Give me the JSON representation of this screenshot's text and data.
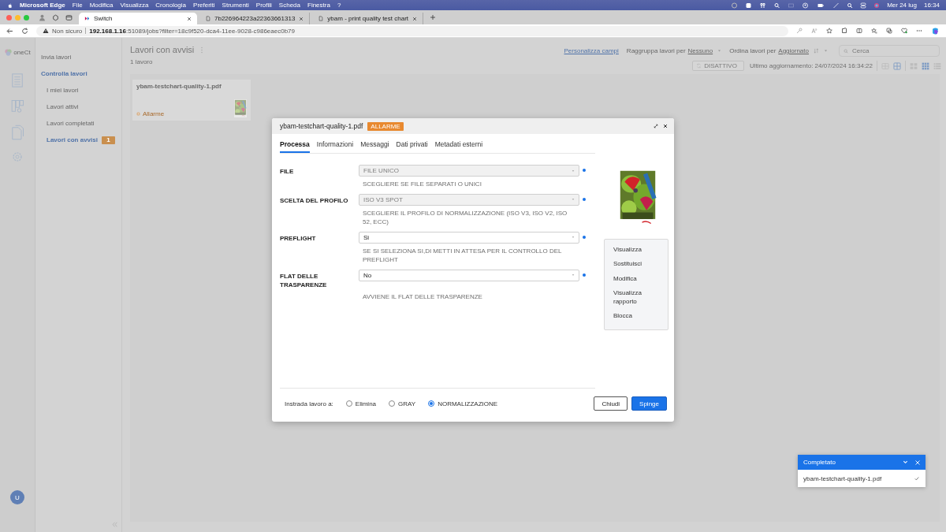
{
  "menubar": {
    "app": "Microsoft Edge",
    "menus": [
      "File",
      "Modifica",
      "Visualizza",
      "Cronologia",
      "Preferiti",
      "Strumenti",
      "Profili",
      "Scheda",
      "Finestra",
      "?"
    ],
    "date": "Mer 24 lug",
    "time": "16:34"
  },
  "browser": {
    "tabs": [
      {
        "title": "Switch",
        "selected": true
      },
      {
        "title": "7b226964223a22363661313",
        "selected": false
      },
      {
        "title": "ybam - print quality test chart",
        "selected": false
      }
    ],
    "security": "Non sicuro",
    "host": "192.168.1.16",
    "path": ":51089/jobs?filter=18c9f520-dca4-11ee-9028-c986eaec0b79"
  },
  "sidebar": {
    "logo": "oneCt",
    "avatar": "U"
  },
  "nav": {
    "items": [
      {
        "label": "Invia lavori",
        "kind": "link"
      },
      {
        "label": "Controlla lavori",
        "kind": "section",
        "children": [
          {
            "label": "I miei lavori",
            "selected": false
          },
          {
            "label": "Lavori attivi",
            "selected": false
          },
          {
            "label": "Lavori completati",
            "selected": false
          },
          {
            "label": "Lavori con avvisi",
            "selected": true,
            "badge": "1"
          }
        ]
      }
    ]
  },
  "main": {
    "title": "Lavori con avvisi",
    "count": "1 lavoro",
    "customize": "Personalizza campi",
    "group_label": "Raggruppa lavori per",
    "group_value": "Nessuno",
    "sort_label": "Ordina lavori per",
    "sort_value": "Aggiornato",
    "search": {
      "placeholder": "Cerca"
    },
    "refresh": "DISATTIVO",
    "last_update": "Ultimo aggiornamento: 24/07/2024 16:34:22",
    "layout_views": [
      {
        "selected": false
      },
      {
        "selected": true
      }
    ],
    "density_views": [
      {
        "selected": false
      },
      {
        "selected": true
      },
      {
        "selected": false
      }
    ],
    "jobs": [
      {
        "name": "ybam-testchart-quality-1.pdf",
        "status": "Allarme"
      }
    ]
  },
  "dialog": {
    "title": "ybam-testchart-quality-1.pdf",
    "badge": "ALLARME",
    "tabs": [
      {
        "label": "Processa",
        "selected": true
      },
      {
        "label": "Informazioni",
        "selected": false
      },
      {
        "label": "Messaggi",
        "selected": false
      },
      {
        "label": "Dati privati",
        "selected": false
      },
      {
        "label": "Metadati esterni",
        "selected": false
      }
    ],
    "fields": [
      {
        "label": "FILE",
        "value": "FILE UNICO",
        "disabled": true,
        "required": true,
        "hint": "SCEGLIERE SE FILE SEPARATI O UNICI"
      },
      {
        "label": "SCELTA DEL PROFILO",
        "value": "ISO V3 SPOT",
        "disabled": true,
        "required": true,
        "hint": "SCEGLIERE IL PROFILO DI NORMALIZZAZIONE (ISO V3, ISO V2, ISO 52, ECC)"
      },
      {
        "label": "PREFLIGHT",
        "value": "Si",
        "disabled": false,
        "required": true,
        "hint": "SE SI SELEZIONA SI,DI METTI IN ATTESA PER IL CONTROLLO DEL PREFLIGHT"
      },
      {
        "label": "FLAT DELLE TRASPARENZE",
        "value": "No",
        "disabled": false,
        "required": true,
        "hint": "AVVIENE IL FLAT DELLE TRASPARENZE"
      }
    ],
    "actions": [
      "Visualizza",
      "Sostituisci",
      "Modifica",
      "Visualizza rapporto",
      "Blocca"
    ],
    "route_label": "Instrada lavoro a:",
    "routes": [
      {
        "label": "Elimina",
        "selected": false
      },
      {
        "label": "GRAY",
        "selected": false
      },
      {
        "label": "NORMALIZZAZIONE",
        "selected": true
      }
    ],
    "buttons": {
      "cancel": "Chiudi",
      "submit": "Spinge"
    }
  },
  "notification": {
    "title": "Completato",
    "items": [
      {
        "name": "ybam-testchart-quality-1.pdf",
        "done": true
      }
    ]
  }
}
